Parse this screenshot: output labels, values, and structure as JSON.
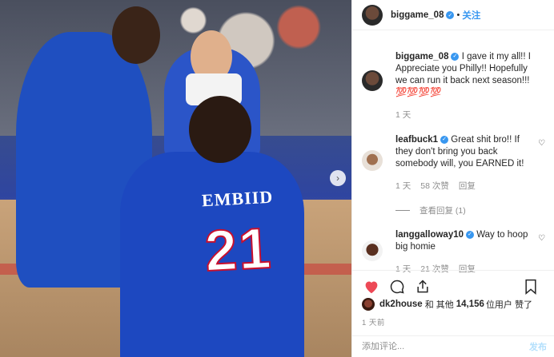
{
  "post": {
    "username": "biggame_08",
    "follow_label": "关注",
    "separator": "•"
  },
  "photo": {
    "jersey_name": "EMBIID",
    "jersey_number": "21",
    "next_icon": "chevron-right-icon"
  },
  "comments": [
    {
      "username": "biggame_08",
      "verified": true,
      "text": "I gave it my all!! I Appreciate you Philly!! Hopefully we can run it back next season!!!",
      "emoji": "💯💯💯💯",
      "time": "1 天"
    },
    {
      "username": "leafbuck1",
      "verified": true,
      "text": "Great shit bro!! If they don't bring you back somebody will, you EARNED it!",
      "time": "1 天",
      "likes": "58 次赞",
      "reply": "回复",
      "view_replies": "查看回复 (1)"
    },
    {
      "username": "langgalloway10",
      "verified": true,
      "text": "Way to hoop big homie",
      "time": "1 天",
      "likes": "21 次赞",
      "reply": "回复"
    }
  ],
  "likes_line": {
    "user": "dk2house",
    "text_mid": "和 其他",
    "count": "14,156",
    "text_end": "位用户 赞了"
  },
  "post_time": "1 天前",
  "add_comment": {
    "placeholder": "添加评论...",
    "post_label": "发布"
  },
  "colors": {
    "accent": "#3897f0",
    "like_red": "#ed4956"
  }
}
